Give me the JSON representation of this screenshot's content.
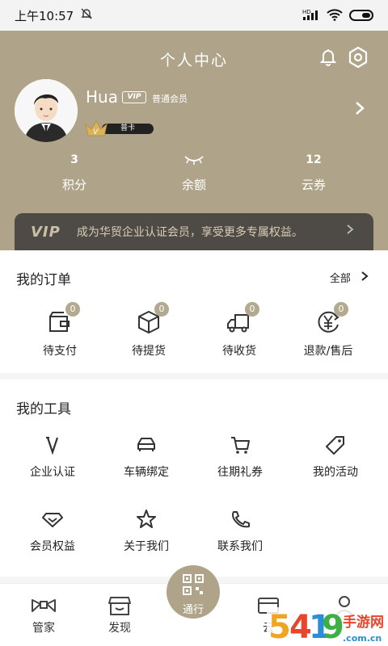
{
  "status": {
    "time": "上午10:57",
    "mute_icon": "bell-off-icon",
    "network": "HD",
    "icons": [
      "signal-icon",
      "wifi-icon",
      "battery-icon"
    ]
  },
  "header": {
    "title": "个人中心",
    "bell_icon": "bell-icon",
    "settings_icon": "settings-icon"
  },
  "profile": {
    "username": "Hua",
    "vip_tag": "VIP",
    "level": "普通会员",
    "card": "普卡"
  },
  "stats": [
    {
      "value": "3",
      "label": "积分"
    },
    {
      "value": "",
      "label": "余额",
      "hidden": true
    },
    {
      "value": "12",
      "label": "云券"
    }
  ],
  "vip_banner": {
    "logo": "VIP",
    "text": "成为华贸企业认证会员，享受更多专属权益。"
  },
  "orders": {
    "title": "我的订单",
    "more": "全部",
    "items": [
      {
        "label": "待支付",
        "count": "0",
        "icon": "wallet-icon"
      },
      {
        "label": "待提货",
        "count": "0",
        "icon": "package-icon"
      },
      {
        "label": "待收货",
        "count": "0",
        "icon": "truck-icon"
      },
      {
        "label": "退款/售后",
        "count": "0",
        "icon": "yen-refund-icon"
      }
    ]
  },
  "tools": {
    "title": "我的工具",
    "items": [
      {
        "label": "企业认证",
        "icon": "enterprise-v-icon"
      },
      {
        "label": "车辆绑定",
        "icon": "car-icon"
      },
      {
        "label": "往期礼券",
        "icon": "cart-icon"
      },
      {
        "label": "我的活动",
        "icon": "tag-icon"
      },
      {
        "label": "会员权益",
        "icon": "diamond-icon"
      },
      {
        "label": "关于我们",
        "icon": "star-icon"
      },
      {
        "label": "联系我们",
        "icon": "phone-icon"
      }
    ]
  },
  "tabbar": {
    "items": [
      {
        "label": "管家",
        "icon": "bowtie-icon"
      },
      {
        "label": "发现",
        "icon": "store-icon"
      },
      {
        "label": "云",
        "icon": "cloud-card-icon"
      },
      {
        "label": "",
        "icon": "person-icon"
      }
    ],
    "center": {
      "label": "通行",
      "icon": "qr-code-icon"
    }
  },
  "colors": {
    "brand": "#afa48a",
    "banner": "#4e4b47",
    "badge": "#b3a98f"
  }
}
